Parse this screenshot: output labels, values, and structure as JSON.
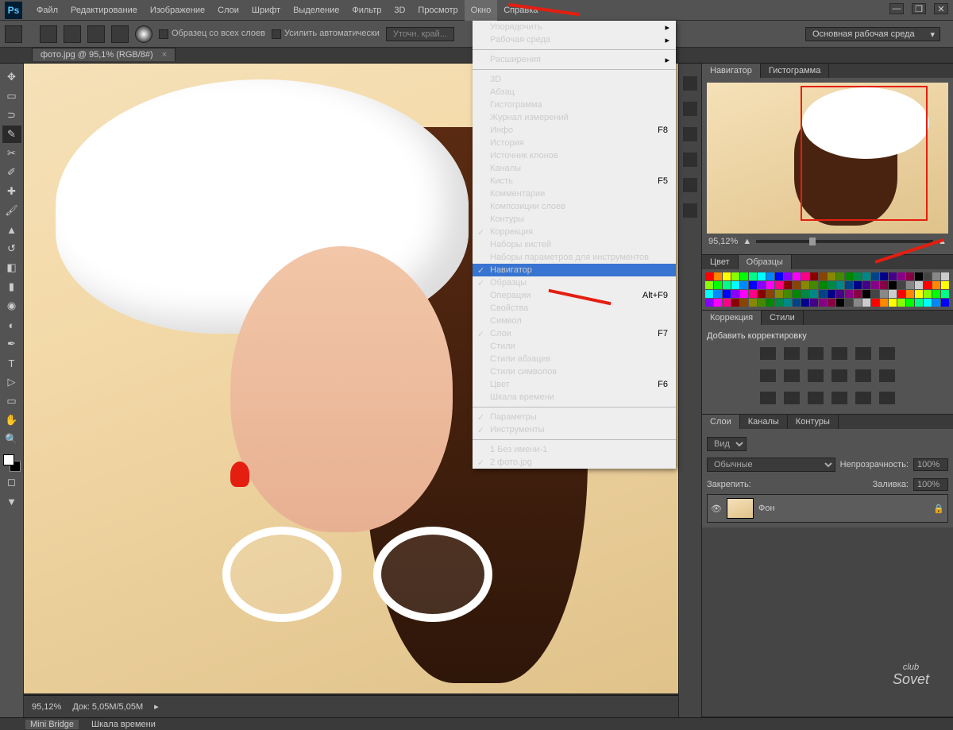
{
  "menubar": [
    "Файл",
    "Редактирование",
    "Изображение",
    "Слои",
    "Шрифт",
    "Выделение",
    "Фильтр",
    "3D",
    "Просмотр",
    "Окно",
    "Справка"
  ],
  "options_bar": {
    "checkbox1": "Образец со всех слоев",
    "checkbox2": "Усилить автоматически",
    "btn": "Уточн. край...",
    "workspace": "Основная рабочая среда"
  },
  "doc_tab": "фото.jpg @ 95,1% (RGB/8#)",
  "canvas_status": {
    "zoom": "95,12%",
    "doc": "Док:  5,05M/5,05M"
  },
  "navigator": {
    "tab1": "Навигатор",
    "tab2": "Гистограмма",
    "zoom": "95,12%"
  },
  "color_panel": {
    "tab1": "Цвет",
    "tab2": "Образцы"
  },
  "adjustments": {
    "tab1": "Коррекция",
    "tab2": "Стили",
    "add_label": "Добавить корректировку"
  },
  "layers_panel": {
    "tab1": "Слои",
    "tab2": "Каналы",
    "tab3": "Контуры",
    "kind": "Вид",
    "blend": "Обычные",
    "opacity_label": "Непрозрачность:",
    "opacity": "100%",
    "lock_label": "Закрепить:",
    "fill_label": "Заливка:",
    "fill": "100%",
    "layer_name": "Фон"
  },
  "dropdown": {
    "group1": [
      {
        "label": "Упорядочить",
        "sub": true
      },
      {
        "label": "Рабочая среда",
        "sub": true
      }
    ],
    "group2": [
      {
        "label": "Расширения",
        "sub": true
      }
    ],
    "group3": [
      {
        "label": "3D"
      },
      {
        "label": "Абзац"
      },
      {
        "label": "Гистограмма"
      },
      {
        "label": "Журнал измерений"
      },
      {
        "label": "Инфо",
        "shortcut": "F8"
      },
      {
        "label": "История"
      },
      {
        "label": "Источник клонов"
      },
      {
        "label": "Каналы"
      },
      {
        "label": "Кисть",
        "shortcut": "F5"
      },
      {
        "label": "Комментарии"
      },
      {
        "label": "Композиции слоев"
      },
      {
        "label": "Контуры"
      },
      {
        "label": "Коррекция",
        "checked": true
      },
      {
        "label": "Наборы кистей"
      },
      {
        "label": "Наборы параметров для инструментов"
      },
      {
        "label": "Навигатор",
        "checked": true,
        "highlight": true
      },
      {
        "label": "Образцы",
        "checked": true
      },
      {
        "label": "Операции",
        "shortcut": "Alt+F9"
      },
      {
        "label": "Свойства"
      },
      {
        "label": "Символ"
      },
      {
        "label": "Слои",
        "checked": true,
        "shortcut": "F7"
      },
      {
        "label": "Стили"
      },
      {
        "label": "Стили абзацев"
      },
      {
        "label": "Стили символов"
      },
      {
        "label": "Цвет",
        "shortcut": "F6"
      },
      {
        "label": "Шкала времени"
      }
    ],
    "group4": [
      {
        "label": "Параметры",
        "checked": true
      },
      {
        "label": "Инструменты",
        "checked": true
      }
    ],
    "group5": [
      {
        "label": "1 Без имени-1"
      },
      {
        "label": "2 фото.jpg",
        "checked": true
      }
    ]
  },
  "minibar": {
    "tab1": "Mini Bridge",
    "tab2": "Шкала времени"
  },
  "watermark": {
    "l1": "club",
    "l2": "Sovet"
  }
}
